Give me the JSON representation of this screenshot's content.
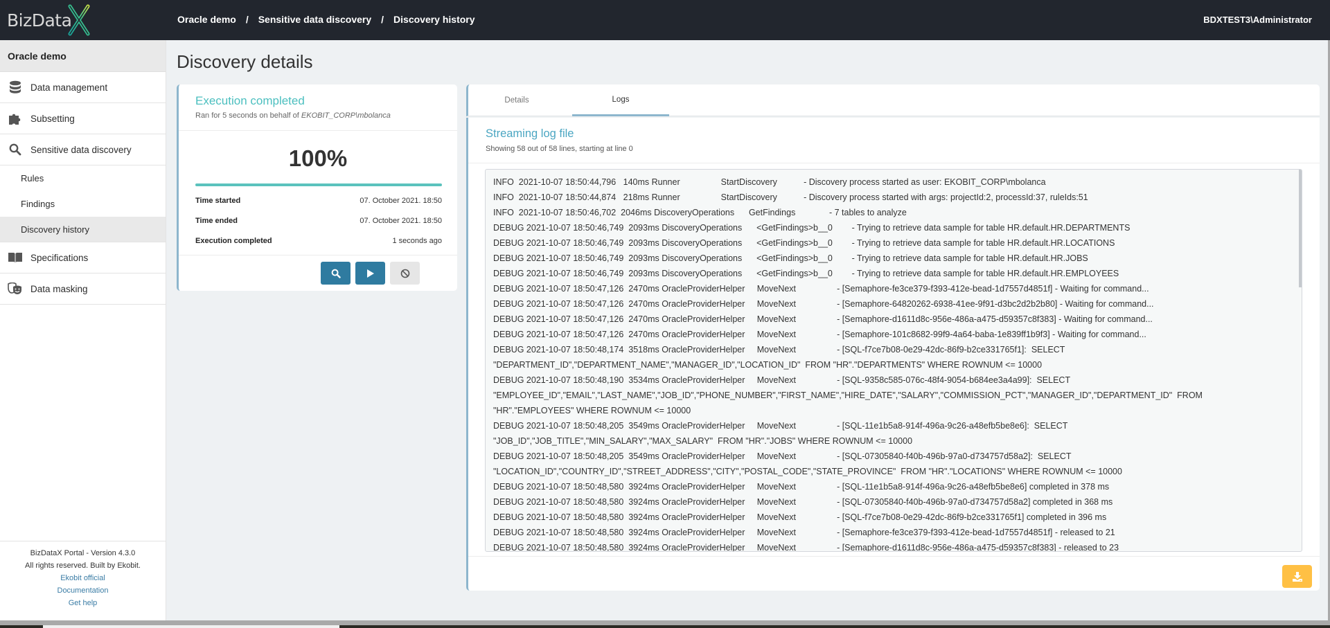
{
  "header": {
    "logo_text": "BizData",
    "logo_accent": "X",
    "breadcrumb": [
      "Oracle demo",
      "Sensitive data discovery",
      "Discovery history"
    ],
    "breadcrumb_separator": "/",
    "user": "BDXTEST3\\Administrator"
  },
  "sidebar": {
    "section_title": "Oracle demo",
    "items": [
      {
        "label": "Data management",
        "icon": "database-icon"
      },
      {
        "label": "Subsetting",
        "icon": "puzzle-icon"
      },
      {
        "label": "Sensitive data discovery",
        "icon": "search-icon"
      }
    ],
    "sub_items": [
      {
        "label": "Rules",
        "active": false
      },
      {
        "label": "Findings",
        "active": false
      },
      {
        "label": "Discovery history",
        "active": true
      }
    ],
    "items_after": [
      {
        "label": "Specifications",
        "icon": "book-icon"
      },
      {
        "label": "Data masking",
        "icon": "masks-icon"
      }
    ],
    "footer": {
      "version": "BizDataX Portal - Version 4.3.0",
      "rights": "All rights reserved. Built by Ekobit.",
      "links": [
        "Ekobit official",
        "Documentation",
        "Get help"
      ]
    }
  },
  "main": {
    "title": "Discovery details",
    "execution": {
      "status": "Execution completed",
      "subtitle_prefix": "Ran for 5 seconds on behalf of ",
      "subtitle_user": "EKOBIT_CORP\\mbolanca",
      "percent_label": "100%",
      "progress_percent": 100,
      "rows": [
        {
          "label": "Time started",
          "value": "07. October 2021. 18:50"
        },
        {
          "label": "Time ended",
          "value": "07. October 2021. 18:50"
        },
        {
          "label": "Execution completed",
          "value": "1 seconds ago"
        }
      ],
      "buttons": [
        {
          "name": "view-findings-button",
          "icon": "search-icon"
        },
        {
          "name": "run-button",
          "icon": "play-icon"
        },
        {
          "name": "cancel-button",
          "icon": "ban-icon",
          "disabled": true
        }
      ]
    },
    "tabs": [
      {
        "label": "Details",
        "active": false
      },
      {
        "label": "Logs",
        "active": true
      }
    ],
    "log": {
      "title": "Streaming log file",
      "subtitle": "Showing 58 out of 58 lines, starting at line 0",
      "lines": [
        "INFO  2021-10-07 18:50:44,796   140ms Runner                 StartDiscovery           - Discovery process started as user: EKOBIT_CORP\\mbolanca",
        "INFO  2021-10-07 18:50:44,874   218ms Runner                 StartDiscovery           - Discovery process started with args: projectId:2, processId:37, ruleIds:51",
        "INFO  2021-10-07 18:50:46,702  2046ms DiscoveryOperations      GetFindings              - 7 tables to analyze",
        "DEBUG 2021-10-07 18:50:46,749  2093ms DiscoveryOperations      <GetFindings>b__0        - Trying to retrieve data sample for table HR.default.HR.DEPARTMENTS",
        "DEBUG 2021-10-07 18:50:46,749  2093ms DiscoveryOperations      <GetFindings>b__0        - Trying to retrieve data sample for table HR.default.HR.LOCATIONS",
        "DEBUG 2021-10-07 18:50:46,749  2093ms DiscoveryOperations      <GetFindings>b__0        - Trying to retrieve data sample for table HR.default.HR.JOBS",
        "DEBUG 2021-10-07 18:50:46,749  2093ms DiscoveryOperations      <GetFindings>b__0        - Trying to retrieve data sample for table HR.default.HR.EMPLOYEES",
        "DEBUG 2021-10-07 18:50:47,126  2470ms OracleProviderHelper     MoveNext                 - [Semaphore-fe3ce379-f393-412e-bead-1d7557d4851f] - Waiting for command...",
        "DEBUG 2021-10-07 18:50:47,126  2470ms OracleProviderHelper     MoveNext                 - [Semaphore-64820262-6938-41ee-9f91-d3bc2d2b2b80] - Waiting for command...",
        "DEBUG 2021-10-07 18:50:47,126  2470ms OracleProviderHelper     MoveNext                 - [Semaphore-d1611d8c-956e-486a-a475-d59357c8f383] - Waiting for command...",
        "DEBUG 2021-10-07 18:50:47,126  2470ms OracleProviderHelper     MoveNext                 - [Semaphore-101c8682-99f9-4a64-baba-1e839ff1b9f3] - Waiting for command...",
        "DEBUG 2021-10-07 18:50:48,174  3518ms OracleProviderHelper     MoveNext                 - [SQL-f7ce7b08-0e29-42dc-86f9-b2ce331765f1]:  SELECT",
        "\"DEPARTMENT_ID\",\"DEPARTMENT_NAME\",\"MANAGER_ID\",\"LOCATION_ID\"  FROM \"HR\".\"DEPARTMENTS\" WHERE ROWNUM <= 10000",
        "DEBUG 2021-10-07 18:50:48,190  3534ms OracleProviderHelper     MoveNext                 - [SQL-9358c585-076c-48f4-9054-b684ee3a4a99]:  SELECT",
        "\"EMPLOYEE_ID\",\"EMAIL\",\"LAST_NAME\",\"JOB_ID\",\"PHONE_NUMBER\",\"FIRST_NAME\",\"HIRE_DATE\",\"SALARY\",\"COMMISSION_PCT\",\"MANAGER_ID\",\"DEPARTMENT_ID\"  FROM",
        "\"HR\".\"EMPLOYEES\" WHERE ROWNUM <= 10000",
        "DEBUG 2021-10-07 18:50:48,205  3549ms OracleProviderHelper     MoveNext                 - [SQL-11e1b5a8-914f-496a-9c26-a48efb5be8e6]:  SELECT",
        "\"JOB_ID\",\"JOB_TITLE\",\"MIN_SALARY\",\"MAX_SALARY\"  FROM \"HR\".\"JOBS\" WHERE ROWNUM <= 10000",
        "DEBUG 2021-10-07 18:50:48,205  3549ms OracleProviderHelper     MoveNext                 - [SQL-07305840-f40b-496b-97a0-d734757d58a2]:  SELECT",
        "\"LOCATION_ID\",\"COUNTRY_ID\",\"STREET_ADDRESS\",\"CITY\",\"POSTAL_CODE\",\"STATE_PROVINCE\"  FROM \"HR\".\"LOCATIONS\" WHERE ROWNUM <= 10000",
        "DEBUG 2021-10-07 18:50:48,580  3924ms OracleProviderHelper     MoveNext                 - [SQL-11e1b5a8-914f-496a-9c26-a48efb5be8e6] completed in 378 ms",
        "DEBUG 2021-10-07 18:50:48,580  3924ms OracleProviderHelper     MoveNext                 - [SQL-07305840-f40b-496b-97a0-d734757d58a2] completed in 368 ms",
        "DEBUG 2021-10-07 18:50:48,580  3924ms OracleProviderHelper     MoveNext                 - [SQL-f7ce7b08-0e29-42dc-86f9-b2ce331765f1] completed in 396 ms",
        "DEBUG 2021-10-07 18:50:48,580  3924ms OracleProviderHelper     MoveNext                 - [Semaphore-fe3ce379-f393-412e-bead-1d7557d4851f] - released to 21",
        "DEBUG 2021-10-07 18:50:48,580  3924ms OracleProviderHelper     MoveNext                 - [Semaphore-d1611d8c-956e-486a-a475-d59357c8f383] - released to 23"
      ],
      "download_icon": "download-icon"
    }
  },
  "colors": {
    "header_bg": "#22262e",
    "accent_teal": "#4bbfbf",
    "progress": "#5bc2bd",
    "primary_button": "#2f7ba0",
    "download_button": "#ffc044",
    "card_border": "#8db6cd"
  }
}
